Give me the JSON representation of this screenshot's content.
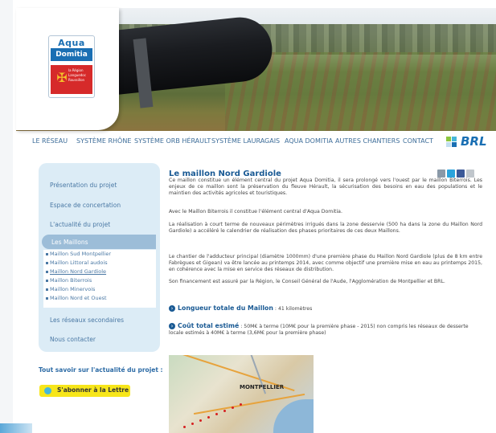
{
  "brand": {
    "logo_aqua": "Aqua",
    "logo_domitia": "Domitia",
    "logo_region": "la Région Languedoc Roussillon",
    "partner": "BRL"
  },
  "nav": [
    "LE RÉSEAU",
    "SYSTÈME RHÔNE",
    "SYSTÈME ORB HÉRAULT",
    "SYSTÈME LAURAGAIS",
    "AQUA DOMITIA",
    "AUTRES CHANTIERS",
    "CONTACT"
  ],
  "sidebar": {
    "links": [
      "Présentation du projet",
      "Espace de concertation",
      "L'actualité du projet"
    ],
    "active": "Les Maillons",
    "sub_items": [
      "Maillon Sud Montpellier",
      "Maillon Littoral audois",
      "Maillon Nord Gardiole",
      "Maillon Biterrois",
      "Maillon Minervois",
      "Maillon Nord et Ouest"
    ],
    "more_links": [
      "Les réseaux secondaires",
      "Nous contacter"
    ],
    "subscribe_title": "Tout savoir sur l'actualité du projet :",
    "subscribe_button": "S'abonner à la Lettre"
  },
  "article": {
    "title": "Le maillon Nord Gardiole",
    "p1": "Ce maillon constitue un élément central du projet Aqua Domitia, il sera prolongé vers l'ouest par le maillon Biterrois. Les enjeux de ce maillon sont la préservation du fleuve Hérault, la sécurisation des besoins en eau des populations et le maintien des activités agricoles et touristiques.",
    "p2": "Avec le Maillon Biterrois il constitue l'élément central d'Aqua Domitia.",
    "p3": "La réalisation à court terme de nouveaux périmètres irrigués dans la zone desservie (500 ha dans la zone du Maillon Nord Gardiole) a accéléré le calendrier de réalisation des phases prioritaires de ces deux Maillons.",
    "p4": "Le chantier de l'adducteur principal (diamètre 1000mm) d'une première phase du Maillon Nord Gardiole (plus de 8 km entre Fabrègues et Gigean) va être lancée au printemps 2014, avec comme objectif une première mise en eau au printemps 2015, en cohérence avec la mise en service des réseaux de distribution.",
    "p5": "Son financement est assuré par la Région, le Conseil Général de l'Aude, l'Agglomération de Montpellier et BRL.",
    "length_label": "Longueur totale du Maillon",
    "length_value": ": 41 kilomètres",
    "cost_label": "Coût total estimé",
    "cost_value": ": 50M€ à terme (10M€ pour la première phase - 2015) non compris les réseaux de desserte locale estimés à 40M€ à terme (3,6M€ pour la première phase)",
    "map_label": "MONTPELLIER"
  },
  "colors": {
    "accent": "#1a5a94",
    "nav_link": "#3d6d99",
    "sidebar_bg": "#dcecf6",
    "active_tab": "#9cbdd8",
    "subscribe_bg": "#f7e61a"
  }
}
